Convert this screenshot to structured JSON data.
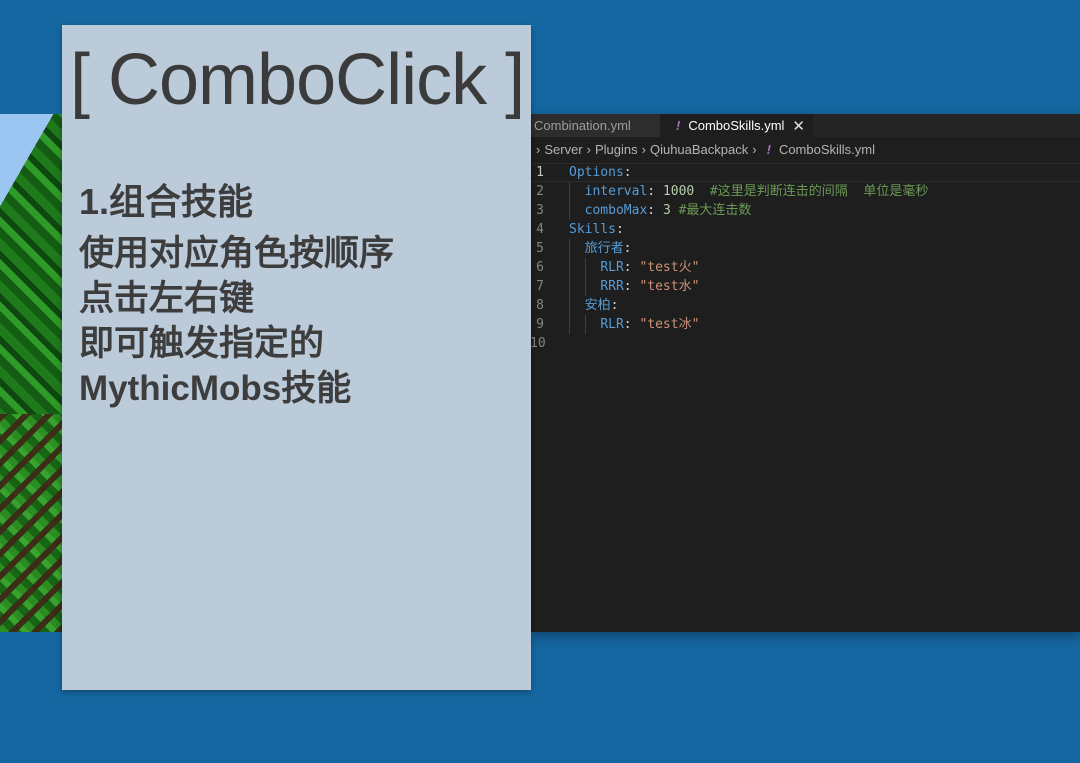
{
  "editor": {
    "tabs": [
      {
        "label": "Combination.yml",
        "active": false
      },
      {
        "label": "ComboSkills.yml",
        "active": true,
        "icon": "!",
        "close": "✕"
      }
    ],
    "breadcrumb": [
      "Server",
      "Plugins",
      "QiuhuaBackpack",
      "ComboSkills.yml"
    ],
    "breadcrumb_icon": "!",
    "lines": [
      {
        "n": "1",
        "parts": [
          {
            "t": "Options",
            "c": "key"
          },
          {
            "t": ":",
            "c": "punct"
          }
        ]
      },
      {
        "n": "2",
        "parts": [
          {
            "t": "  "
          },
          {
            "t": "interval",
            "c": "key"
          },
          {
            "t": ": ",
            "c": "punct"
          },
          {
            "t": "1000",
            "c": "num"
          },
          {
            "t": "  "
          },
          {
            "t": "#这里是判断连击的间隔  单位是毫秒",
            "c": "cmt"
          }
        ]
      },
      {
        "n": "3",
        "parts": [
          {
            "t": "  "
          },
          {
            "t": "comboMax",
            "c": "key"
          },
          {
            "t": ": ",
            "c": "punct"
          },
          {
            "t": "3",
            "c": "num"
          },
          {
            "t": " "
          },
          {
            "t": "#最大连击数",
            "c": "cmt"
          }
        ]
      },
      {
        "n": "4",
        "parts": [
          {
            "t": "Skills",
            "c": "key"
          },
          {
            "t": ":",
            "c": "punct"
          }
        ]
      },
      {
        "n": "5",
        "parts": [
          {
            "t": "  "
          },
          {
            "t": "旅行者",
            "c": "key"
          },
          {
            "t": ":",
            "c": "punct"
          }
        ]
      },
      {
        "n": "6",
        "parts": [
          {
            "t": "    "
          },
          {
            "t": "RLR",
            "c": "key"
          },
          {
            "t": ": ",
            "c": "punct"
          },
          {
            "t": "\"test火\"",
            "c": "str"
          }
        ]
      },
      {
        "n": "7",
        "parts": [
          {
            "t": "    "
          },
          {
            "t": "RRR",
            "c": "key"
          },
          {
            "t": ": ",
            "c": "punct"
          },
          {
            "t": "\"test水\"",
            "c": "str"
          }
        ]
      },
      {
        "n": "8",
        "parts": [
          {
            "t": "  "
          },
          {
            "t": "安柏",
            "c": "key"
          },
          {
            "t": ":",
            "c": "punct"
          }
        ]
      },
      {
        "n": "9",
        "parts": [
          {
            "t": "    "
          },
          {
            "t": "RLR",
            "c": "key"
          },
          {
            "t": ": ",
            "c": "punct"
          },
          {
            "t": "\"test冰\"",
            "c": "str"
          }
        ]
      },
      {
        "n": "10",
        "parts": []
      }
    ]
  },
  "card": {
    "title": "[ ComboClick ]",
    "heading": "1.组合技能",
    "lines": [
      "使用对应角色按顺序",
      "点击左右键",
      "即可触发指定的",
      "MythicMobs技能"
    ]
  }
}
